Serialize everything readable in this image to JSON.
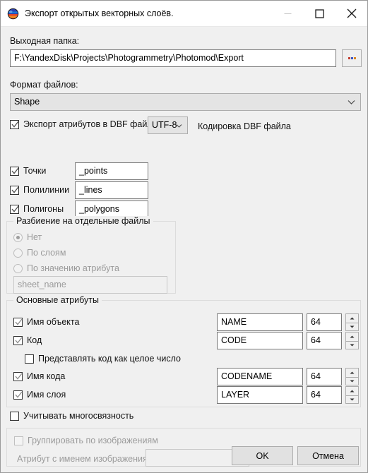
{
  "window": {
    "title": "Экспорт открытых векторных слоёв.",
    "icon": "globe-icon",
    "minimize_label": "minimize-icon",
    "maximize_label": "maximize-icon",
    "close_label": "close-icon"
  },
  "output_folder": {
    "label": "Выходная папка:",
    "value": "F:\\YandexDisk\\Projects\\Photogrammetry\\Photomod\\Export",
    "browse_label": "..."
  },
  "file_format": {
    "label": "Формат файлов:",
    "value": "Shape"
  },
  "dbf": {
    "export_attributes_label": "Экспорт атрибутов в DBF файл",
    "export_attributes_checked": true,
    "encoding_value": "UTF-8",
    "encoding_caption": "Кодировка DBF файла"
  },
  "geometry": [
    {
      "label": "Точки",
      "checked": true,
      "suffix": "_points"
    },
    {
      "label": "Полилинии",
      "checked": true,
      "suffix": "_lines"
    },
    {
      "label": "Полигоны",
      "checked": true,
      "suffix": "_polygons"
    }
  ],
  "split_group": {
    "title": "Разбиение на отдельные файлы",
    "options": [
      {
        "label": "Нет",
        "selected": true
      },
      {
        "label": "По слоям",
        "selected": false
      },
      {
        "label": "По значению атрибута",
        "selected": false
      }
    ],
    "attribute_value": "sheet_name"
  },
  "main_attributes": {
    "title": "Основные атрибуты",
    "rows": [
      {
        "label": "Имя объекта",
        "checked": true,
        "name": "NAME",
        "width": "64"
      },
      {
        "label": "Код",
        "checked": true,
        "name": "CODE",
        "width": "64"
      },
      {
        "label": "Имя кода",
        "checked": true,
        "name": "CODENAME",
        "width": "64"
      },
      {
        "label": "Имя слоя",
        "checked": true,
        "name": "LAYER",
        "width": "64"
      }
    ],
    "code_as_integer_label": "Представлять код как целое число",
    "code_as_integer_checked": false
  },
  "multiconnectivity": {
    "label": "Учитывать многосвязность",
    "checked": false
  },
  "grouping": {
    "group_by_images_label": "Группировать по изображениям",
    "group_by_images_checked": false,
    "attribute_label": "Атрибут с именем изображения:",
    "attribute_value": ""
  },
  "footer": {
    "ok_label": "OK",
    "cancel_label": "Отмена"
  },
  "colors": {
    "dialog_bg": "#f0f0f0",
    "titlebar_bg": "#ffffff",
    "field_border": "#7a7a7a",
    "disabled_text": "#9b9b9b"
  }
}
